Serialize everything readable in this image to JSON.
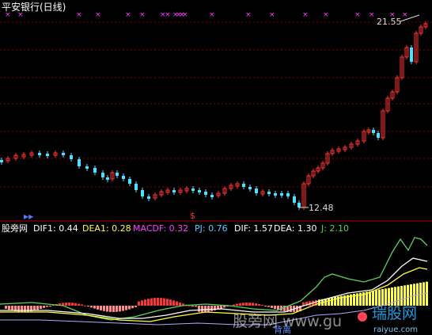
{
  "header": {
    "title": "平安银行(日线)",
    "price_high_label": "21.55",
    "price_low_label": "12.48",
    "marker_dollar": "$",
    "marker_arrow": "▶▶"
  },
  "indicator": {
    "name": "股旁网",
    "dif1": "DIF1: 0.44",
    "dea1": "DEA1: 0.28",
    "macdf": "MACDF: 0.32",
    "pj": "PJ: 0.76",
    "dif": "DIF: 1.57",
    "dea": "DEA: 1.30",
    "j": "J: 2.10",
    "bottom_label": "背离"
  },
  "watermark": {
    "text1": "股旁网 www.gu",
    "text2": "aiyue",
    "logo_text": "瑞股网",
    "logo_sub": "raiyue.com"
  },
  "colors": {
    "up": "#ff3333",
    "down": "#4fe0ff",
    "magenta": "#ff40ff",
    "yellow": "#ffff44",
    "white": "#ffffff",
    "green": "#5bd35b",
    "pj": "#55d0ff",
    "grid": "#8b0000"
  },
  "chart_data": {
    "type": "candlestick",
    "price_high": 21.55,
    "price_low": 12.48
  }
}
